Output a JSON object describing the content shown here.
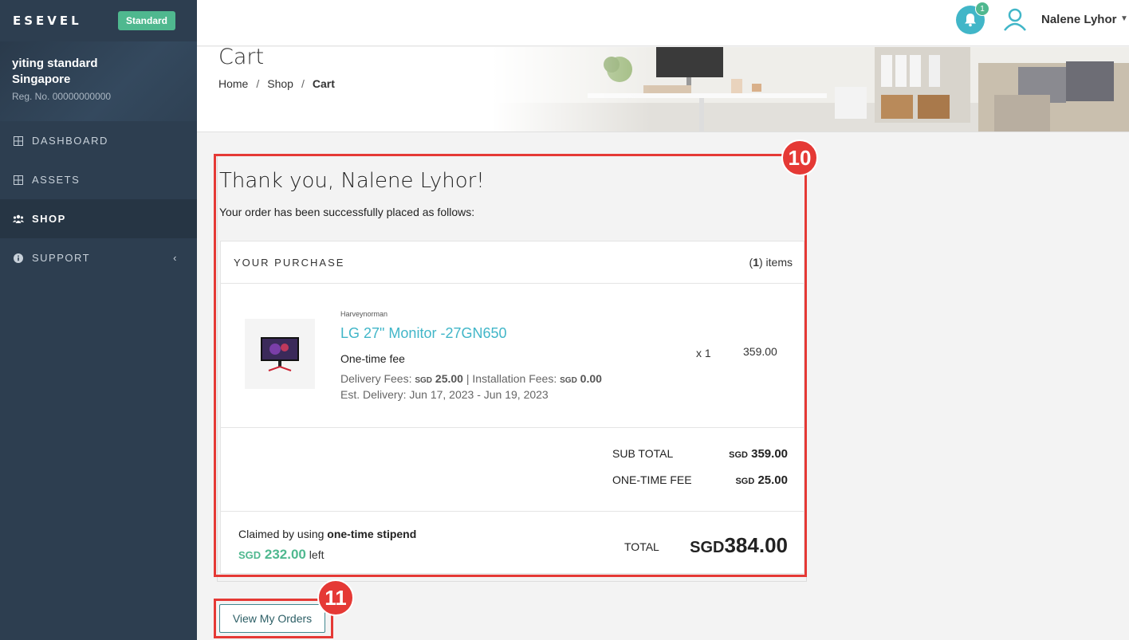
{
  "sidebar": {
    "brand": "ESEVEL",
    "plan": "Standard",
    "company_name": "yiting standard",
    "company_country": "Singapore",
    "reg_no": "Reg. No. 00000000000",
    "items": [
      {
        "label": "DASHBOARD",
        "icon": "grid-icon"
      },
      {
        "label": "ASSETS",
        "icon": "grid-icon"
      },
      {
        "label": "SHOP",
        "icon": "users-icon",
        "active": true
      },
      {
        "label": "SUPPORT",
        "icon": "info-icon"
      }
    ]
  },
  "topbar": {
    "notification_count": "1",
    "user_name": "Nalene Lyhor"
  },
  "header": {
    "title": "Cart",
    "breadcrumb": [
      "Home",
      "Shop",
      "Cart"
    ],
    "separator": "/"
  },
  "order": {
    "thanks": "Thank you, Nalene Lyhor!",
    "placed_text": "Your order has been successfully placed as follows:",
    "purchase_label": "YOUR PURCHASE",
    "items_count": "1",
    "items_suffix": " items",
    "item": {
      "vendor": "Harveynorman",
      "name": "LG 27\" Monitor -27GN650",
      "fee_type": "One-time fee",
      "delivery_label": "Delivery Fees: ",
      "delivery_currency": "SGD",
      "delivery_amount": " 25.00",
      "installation_label": "Installation Fees: ",
      "installation_currency": "SGD",
      "installation_amount": " 0.00",
      "est_delivery": "Est. Delivery: Jun 17, 2023 - Jun 19, 2023",
      "qty": "x 1",
      "price": "359.00"
    },
    "subtotal_label": "SUB TOTAL",
    "subtotal_currency": "SGD",
    "subtotal_amount": " 359.00",
    "onetime_label": "ONE-TIME FEE",
    "onetime_currency": "SGD",
    "onetime_amount": " 25.00",
    "claimed_prefix": "Claimed by using ",
    "claimed_method": "one-time stipend",
    "stipend_currency": "SGD",
    "stipend_amount": " 232.00",
    "stipend_suffix": " left",
    "total_label": "TOTAL",
    "total_currency": "SGD",
    "total_amount": "384.00"
  },
  "view_orders_label": "View My Orders",
  "annotations": {
    "marker_10": "10",
    "marker_11": "11"
  },
  "colors": {
    "accent": "#41b6c8",
    "green": "#4fb88f",
    "sidebar": "#2d3e50",
    "highlight": "#e53935"
  }
}
